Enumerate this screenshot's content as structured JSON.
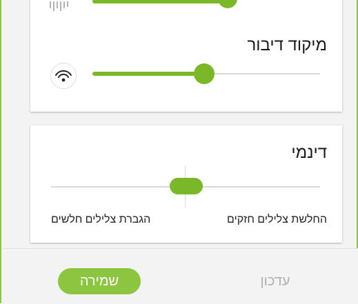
{
  "speech_focus": {
    "title": "מיקוד דיבור",
    "level": 0.42,
    "icon": "hearing-focus-icon"
  },
  "dynamic": {
    "title": "דינמי",
    "label_right": "החלשת צלילים חזקים",
    "label_left": "הגברת צלילים חלשים",
    "value": 0.0
  },
  "footer": {
    "save_label": "שמירה",
    "update_label": "עדכון"
  },
  "colors": {
    "accent": "#8cc63f",
    "slider": "#7ab829",
    "track": "#d9d9d9"
  }
}
